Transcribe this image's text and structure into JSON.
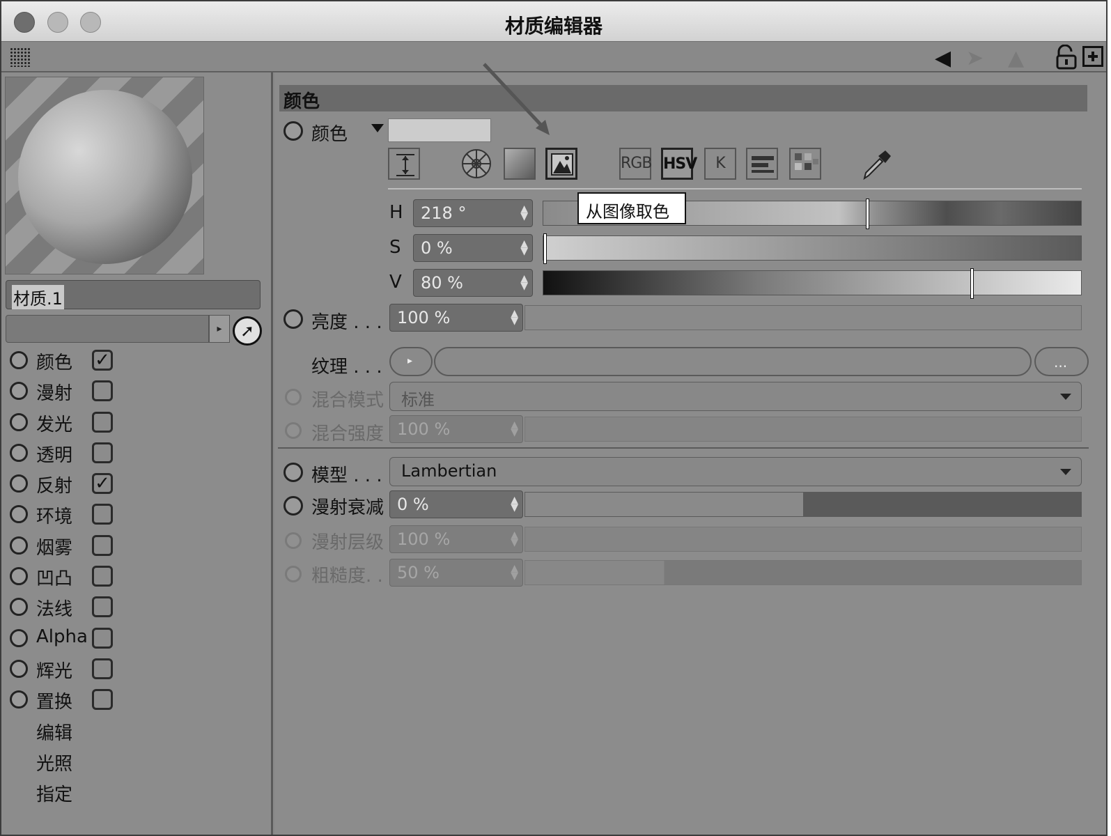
{
  "window": {
    "title": "材质编辑器"
  },
  "material": {
    "name": "材质.1"
  },
  "channels": [
    {
      "label": "颜色",
      "checked": true
    },
    {
      "label": "漫射",
      "checked": false
    },
    {
      "label": "发光",
      "checked": false
    },
    {
      "label": "透明",
      "checked": false
    },
    {
      "label": "反射",
      "checked": true
    },
    {
      "label": "环境",
      "checked": false
    },
    {
      "label": "烟雾",
      "checked": false
    },
    {
      "label": "凹凸",
      "checked": false
    },
    {
      "label": "法线",
      "checked": false
    },
    {
      "label": "Alpha",
      "checked": false
    },
    {
      "label": "辉光",
      "checked": false
    },
    {
      "label": "置换",
      "checked": false
    }
  ],
  "extra_items": [
    "编辑",
    "光照",
    "指定"
  ],
  "color_section": {
    "header": "颜色",
    "color_label": "颜色",
    "tools": [
      "RGB",
      "HSV",
      "K"
    ],
    "tooltip": "从图像取色",
    "h": {
      "label": "H",
      "value": "218 °",
      "fraction": 0.605
    },
    "s": {
      "label": "S",
      "value": "0 %",
      "fraction": 0.0
    },
    "v": {
      "label": "V",
      "value": "80 %",
      "fraction": 0.8
    },
    "brightness": {
      "label": "亮度 . . .",
      "value": "100 %"
    },
    "texture": {
      "label": "纹理 . . .",
      "more": "..."
    },
    "blend_mode": {
      "label": "混合模式",
      "value": "标准"
    },
    "blend_strength": {
      "label": "混合强度",
      "value": "100 %"
    }
  },
  "model_section": {
    "model": {
      "label": "模型 . . .",
      "value": "Lambertian"
    },
    "diffuse_falloff": {
      "label": "漫射衰减",
      "value": "0 %"
    },
    "diffuse_level": {
      "label": "漫射层级",
      "value": "100 %"
    },
    "roughness": {
      "label": "粗糙度. .",
      "value": "50 %"
    }
  },
  "colors": {
    "window_bg": "#8a8a8a",
    "tooltip_bg": "#ffffff"
  }
}
